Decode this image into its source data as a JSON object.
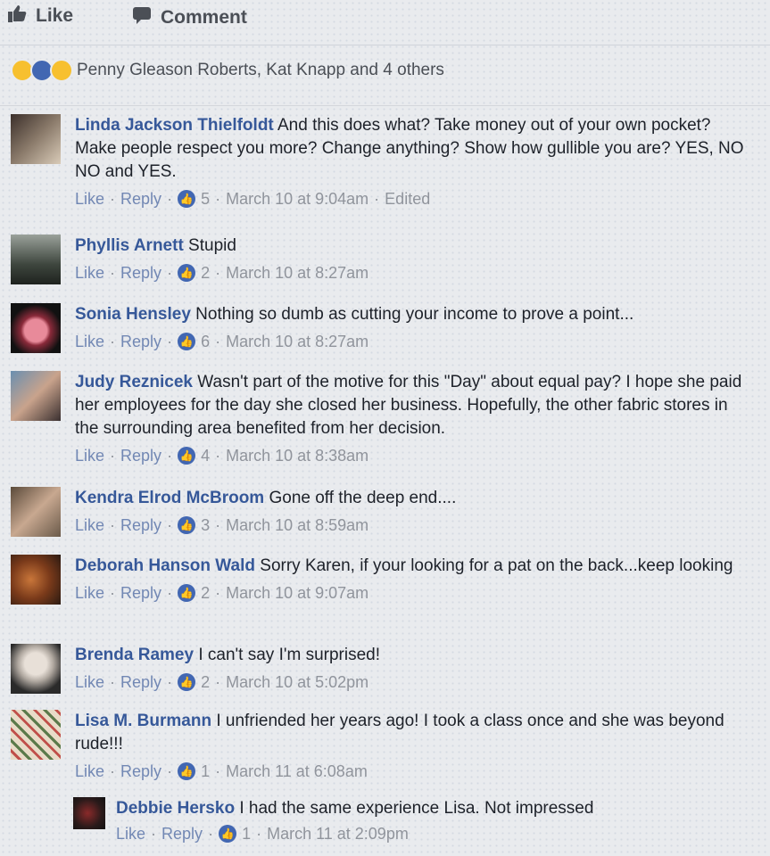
{
  "actions": {
    "like_label": "Like",
    "comment_label": "Comment"
  },
  "reactions": {
    "summary": "Penny Gleason Roberts, Kat Knapp and 4 others"
  },
  "comments": [
    {
      "author": "Linda Jackson Thielfoldt",
      "text": "And this does what? Take money out of your own pocket? Make people respect you more? Change anything? Show how gullible you are? YES, NO NO and YES.",
      "like": "Like",
      "reply": "Reply",
      "count": "5",
      "time": "March 10 at 9:04am",
      "edited": "Edited"
    },
    {
      "author": "Phyllis Arnett",
      "text": "Stupid",
      "like": "Like",
      "reply": "Reply",
      "count": "2",
      "time": "March 10 at 8:27am"
    },
    {
      "author": "Sonia Hensley",
      "text": "Nothing so dumb as cutting your income to prove a point...",
      "like": "Like",
      "reply": "Reply",
      "count": "6",
      "time": "March 10 at 8:27am"
    },
    {
      "author": "Judy Reznicek",
      "text": "Wasn't part of the motive for this \"Day\" about equal pay? I hope she paid her employees for the day she closed her business. Hopefully, the other fabric stores in the surrounding area benefited from her decision.",
      "like": "Like",
      "reply": "Reply",
      "count": "4",
      "time": "March 10 at 8:38am"
    },
    {
      "author": "Kendra Elrod McBroom",
      "text": "Gone off the deep end....",
      "like": "Like",
      "reply": "Reply",
      "count": "3",
      "time": "March 10 at 8:59am"
    },
    {
      "author": "Deborah Hanson Wald",
      "text": "Sorry Karen, if your looking for a pat on the back...keep looking",
      "like": "Like",
      "reply": "Reply",
      "count": "2",
      "time": "March 10 at 9:07am"
    },
    {
      "author": "Brenda Ramey",
      "text": "I can't say I'm surprised!",
      "like": "Like",
      "reply": "Reply",
      "count": "2",
      "time": "March 10 at 5:02pm"
    },
    {
      "author": "Lisa M. Burmann",
      "text": "I unfriended her years ago! I took a class once and she was beyond rude!!!",
      "like": "Like",
      "reply": "Reply",
      "count": "1",
      "time": "March 11 at 6:08am"
    }
  ],
  "reply": {
    "author": "Debbie Hersko",
    "text": "I had the same experience Lisa. Not impressed",
    "like": "Like",
    "reply": "Reply",
    "count": "1",
    "time": "March 11 at 2:09pm"
  },
  "colors": {
    "link": "#365899",
    "like_blue": "#4267b2",
    "meta_gray": "#90949c"
  }
}
